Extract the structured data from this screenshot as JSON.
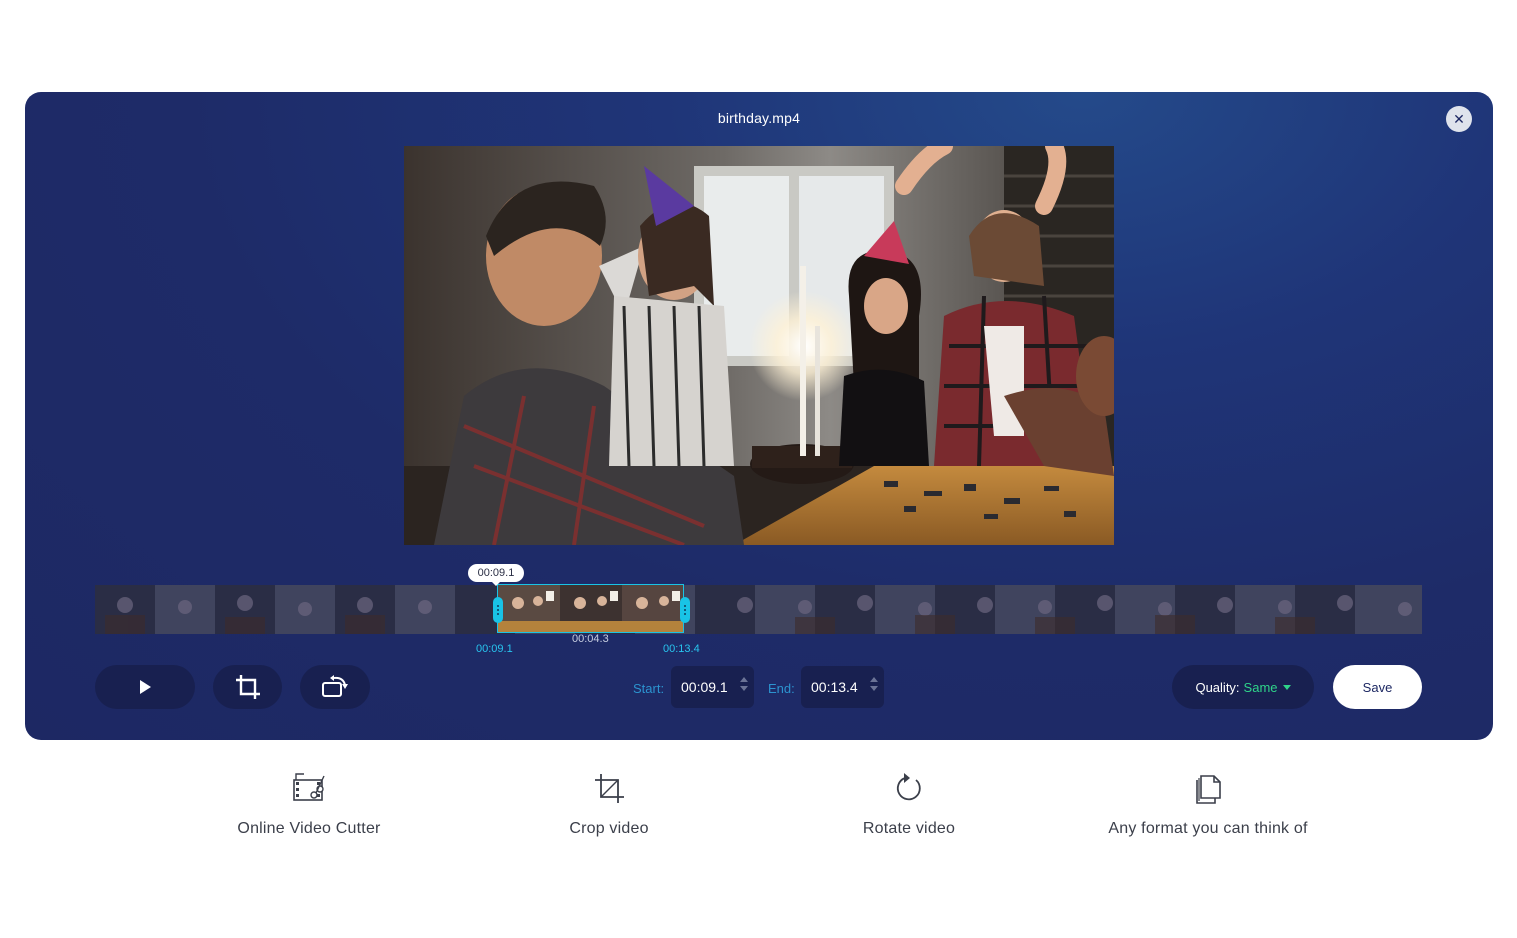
{
  "editor": {
    "file_name": "birthday.mp4",
    "close_icon": "close-icon",
    "preview_description_icon": "video-preview",
    "timeline": {
      "current_time": "00:09.1",
      "selection_start": "00:09.1",
      "selection_end": "00:13.4",
      "selection_duration": "00:04.3"
    },
    "controls": {
      "play_icon": "play-icon",
      "crop_icon": "crop-icon",
      "rotate_icon": "rotate-icon"
    },
    "start": {
      "label": "Start:",
      "value": "00:09.1"
    },
    "end": {
      "label": "End:",
      "value": "00:13.4"
    },
    "quality": {
      "label": "Quality:",
      "value": "Same"
    },
    "save_label": "Save",
    "colors": {
      "panel": "#1e2b68",
      "button": "#182050",
      "accent": "#19c3e6",
      "quality_value": "#2fd48a"
    }
  },
  "features": [
    {
      "label": "Online Video Cutter",
      "icon": "film-cut-icon"
    },
    {
      "label": "Crop video",
      "icon": "crop-icon"
    },
    {
      "label": "Rotate video",
      "icon": "rotate-icon"
    },
    {
      "label": "Any format you can think of",
      "icon": "files-icon"
    }
  ]
}
